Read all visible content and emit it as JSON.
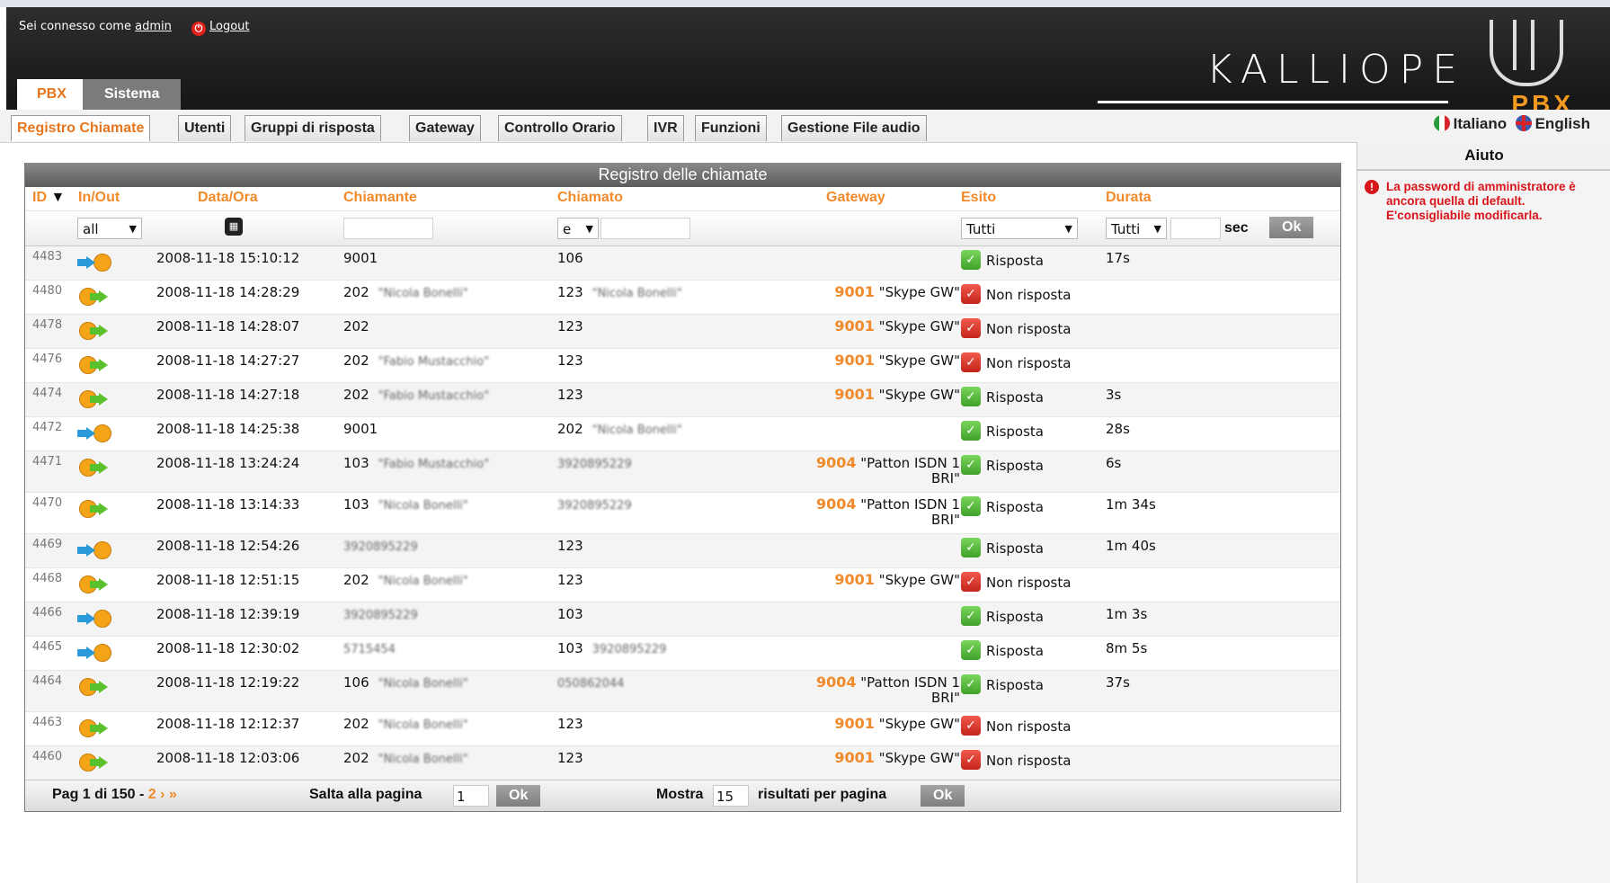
{
  "header": {
    "connected_prefix": "Sei connesso come",
    "username": "admin",
    "logout_label": "Logout",
    "logo_text": "KALLIOPE",
    "logo_sub": "PBX"
  },
  "main_tabs": [
    {
      "label": "PBX",
      "active": true
    },
    {
      "label": "Sistema",
      "active": false
    }
  ],
  "sub_tabs": [
    {
      "label": "Registro Chiamate",
      "active": true
    },
    {
      "label": "Utenti"
    },
    {
      "label": "Gruppi di risposta"
    },
    {
      "label": "Gateway"
    },
    {
      "label": "Controllo Orario"
    },
    {
      "label": "IVR"
    },
    {
      "label": "Funzioni"
    },
    {
      "label": "Gestione File audio"
    }
  ],
  "languages": {
    "italian": "Italiano",
    "english": "English"
  },
  "sidebar": {
    "title": "Aiuto",
    "warning": "La password di amministratore è ancora quella di default. E'consigliabile modificarla."
  },
  "panel": {
    "title": "Registro delle chiamate",
    "columns": {
      "id": "ID",
      "sort_indicator": "▼",
      "inout": "In/Out",
      "datetime": "Data/Ora",
      "caller": "Chiamante",
      "called": "Chiamato",
      "gateway": "Gateway",
      "outcome": "Esito",
      "duration": "Durata"
    },
    "filters": {
      "inout_value": "all",
      "called_op": "e",
      "outcome_value": "Tutti",
      "duration_op": "Tutti",
      "sec_label": "sec",
      "ok_label": "Ok"
    },
    "rows": [
      {
        "id": "4483",
        "dir": "in",
        "datetime": "2008-11-18 15:10:12",
        "caller": "9001",
        "caller_name": "",
        "called": "106",
        "called_name": "",
        "gw_num": "",
        "gw_name": "",
        "outcome": "Risposta",
        "answered": true,
        "duration": "17s"
      },
      {
        "id": "4480",
        "dir": "out",
        "datetime": "2008-11-18 14:28:29",
        "caller": "202",
        "caller_name": "\"Nicola Bonelli\"",
        "called": "123",
        "called_name": "\"Nicola Bonelli\"",
        "gw_num": "9001",
        "gw_name": "\"Skype GW\"",
        "outcome": "Non risposta",
        "answered": false,
        "duration": ""
      },
      {
        "id": "4478",
        "dir": "out",
        "datetime": "2008-11-18 14:28:07",
        "caller": "202",
        "caller_name": "",
        "called": "123",
        "called_name": "",
        "gw_num": "9001",
        "gw_name": "\"Skype GW\"",
        "outcome": "Non risposta",
        "answered": false,
        "duration": ""
      },
      {
        "id": "4476",
        "dir": "out",
        "datetime": "2008-11-18 14:27:27",
        "caller": "202",
        "caller_name": "\"Fabio Mustacchio\"",
        "called": "123",
        "called_name": "",
        "gw_num": "9001",
        "gw_name": "\"Skype GW\"",
        "outcome": "Non risposta",
        "answered": false,
        "duration": ""
      },
      {
        "id": "4474",
        "dir": "out",
        "datetime": "2008-11-18 14:27:18",
        "caller": "202",
        "caller_name": "\"Fabio Mustacchio\"",
        "called": "123",
        "called_name": "",
        "gw_num": "9001",
        "gw_name": "\"Skype GW\"",
        "outcome": "Risposta",
        "answered": true,
        "duration": "3s"
      },
      {
        "id": "4472",
        "dir": "in",
        "datetime": "2008-11-18 14:25:38",
        "caller": "9001",
        "caller_name": "",
        "called": "202",
        "called_name": "\"Nicola Bonelli\"",
        "gw_num": "",
        "gw_name": "",
        "outcome": "Risposta",
        "answered": true,
        "duration": "28s"
      },
      {
        "id": "4471",
        "dir": "out",
        "datetime": "2008-11-18 13:24:24",
        "caller": "103",
        "caller_name": "\"Fabio Mustacchio\"",
        "called": "",
        "called_name": "3920895229",
        "gw_num": "9004",
        "gw_name": "\"Patton ISDN 1 BRI\"",
        "outcome": "Risposta",
        "answered": true,
        "duration": "6s"
      },
      {
        "id": "4470",
        "dir": "out",
        "datetime": "2008-11-18 13:14:33",
        "caller": "103",
        "caller_name": "\"Nicola Bonelli\"",
        "called": "",
        "called_name": "3920895229",
        "gw_num": "9004",
        "gw_name": "\"Patton ISDN 1 BRI\"",
        "outcome": "Risposta",
        "answered": true,
        "duration": "1m 34s"
      },
      {
        "id": "4469",
        "dir": "in",
        "datetime": "2008-11-18 12:54:26",
        "caller": "",
        "caller_name": "3920895229",
        "called": "123",
        "called_name": "",
        "gw_num": "",
        "gw_name": "",
        "outcome": "Risposta",
        "answered": true,
        "duration": "1m 40s"
      },
      {
        "id": "4468",
        "dir": "out",
        "datetime": "2008-11-18 12:51:15",
        "caller": "202",
        "caller_name": "\"Nicola Bonelli\"",
        "called": "123",
        "called_name": "",
        "gw_num": "9001",
        "gw_name": "\"Skype GW\"",
        "outcome": "Non risposta",
        "answered": false,
        "duration": ""
      },
      {
        "id": "4466",
        "dir": "in",
        "datetime": "2008-11-18 12:39:19",
        "caller": "",
        "caller_name": "3920895229",
        "called": "103",
        "called_name": "",
        "gw_num": "",
        "gw_name": "",
        "outcome": "Risposta",
        "answered": true,
        "duration": "1m 3s"
      },
      {
        "id": "4465",
        "dir": "in",
        "datetime": "2008-11-18 12:30:02",
        "caller": "",
        "caller_name": "5715454",
        "called": "103",
        "called_name": "3920895229",
        "gw_num": "",
        "gw_name": "",
        "outcome": "Risposta",
        "answered": true,
        "duration": "8m 5s"
      },
      {
        "id": "4464",
        "dir": "out",
        "datetime": "2008-11-18 12:19:22",
        "caller": "106",
        "caller_name": "\"Nicola Bonelli\"",
        "called": "",
        "called_name": "050862044",
        "gw_num": "9004",
        "gw_name": "\"Patton ISDN 1 BRI\"",
        "outcome": "Risposta",
        "answered": true,
        "duration": "37s"
      },
      {
        "id": "4463",
        "dir": "out",
        "datetime": "2008-11-18 12:12:37",
        "caller": "202",
        "caller_name": "\"Nicola Bonelli\"",
        "called": "123",
        "called_name": "",
        "gw_num": "9001",
        "gw_name": "\"Skype GW\"",
        "outcome": "Non risposta",
        "answered": false,
        "duration": ""
      },
      {
        "id": "4460",
        "dir": "out",
        "datetime": "2008-11-18 12:03:06",
        "caller": "202",
        "caller_name": "\"Nicola Bonelli\"",
        "called": "123",
        "called_name": "",
        "gw_num": "9001",
        "gw_name": "\"Skype GW\"",
        "outcome": "Non risposta",
        "answered": false,
        "duration": ""
      }
    ],
    "footer": {
      "page_text": "Pag 1 di 150 -",
      "next_page": "2",
      "next_arrows": "› »",
      "jump_label": "Salta alla pagina",
      "jump_value": "1",
      "show_label": "Mostra",
      "show_value": "15",
      "per_page_label": "risultati per pagina",
      "ok_label": "Ok"
    }
  },
  "colors": {
    "accent_orange": "#f08a2a",
    "answered_green": "#3fa12a",
    "missed_red": "#c4231a",
    "header_dark": "#1f1f1f"
  }
}
